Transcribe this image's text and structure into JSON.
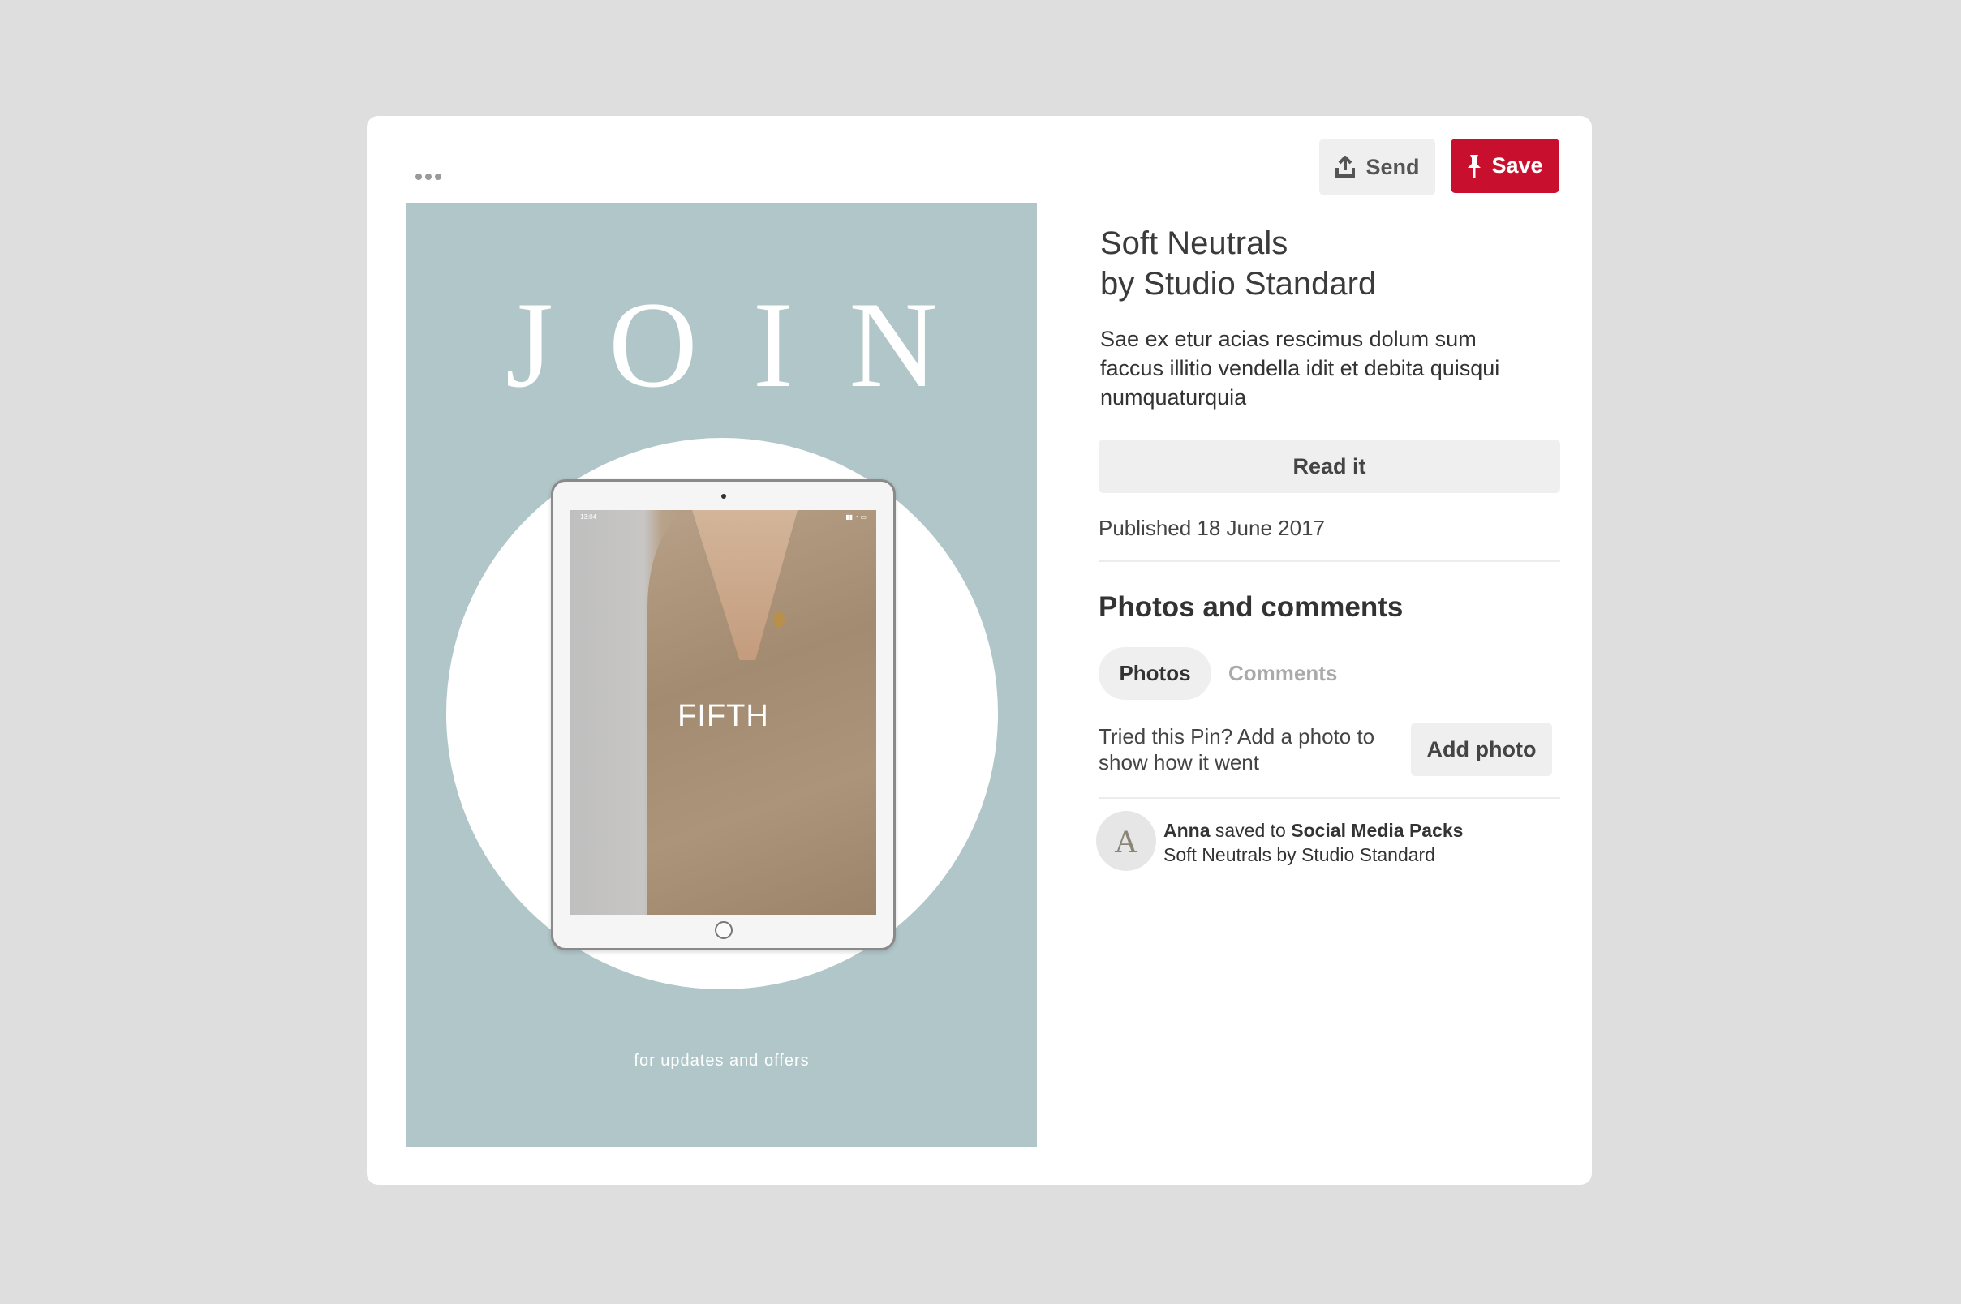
{
  "header": {
    "more_icon": "more-horizontal-icon",
    "send_label": "Send",
    "send_icon": "share-upload-icon",
    "save_label": "Save",
    "save_icon": "pin-icon",
    "save_color": "#c8102e"
  },
  "pin_image": {
    "headline": "JOIN",
    "device_screen_text": "FIFTH",
    "device_status_time": "13:04",
    "caption": "for updates and offers",
    "background_color": "#b1c6c9"
  },
  "details": {
    "title_line1": "Soft Neutrals",
    "title_line2": "by Studio Standard",
    "description": "Sae ex etur acias rescimus dolum sum faccus illitio vendella idit et debita quisqui numquaturquia",
    "read_button": "Read it",
    "published": "Published 18 June 2017"
  },
  "photos_comments": {
    "section_title": "Photos and comments",
    "tabs": [
      {
        "label": "Photos",
        "active": true
      },
      {
        "label": "Comments",
        "active": false
      }
    ],
    "prompt": "Tried this Pin? Add a photo to show how it went",
    "add_photo_button": "Add photo"
  },
  "activity": {
    "avatar_letter": "A",
    "user": "Anna",
    "action": "saved to",
    "board": "Social Media Packs",
    "pin_name": "Soft Neutrals by Studio Standard"
  }
}
